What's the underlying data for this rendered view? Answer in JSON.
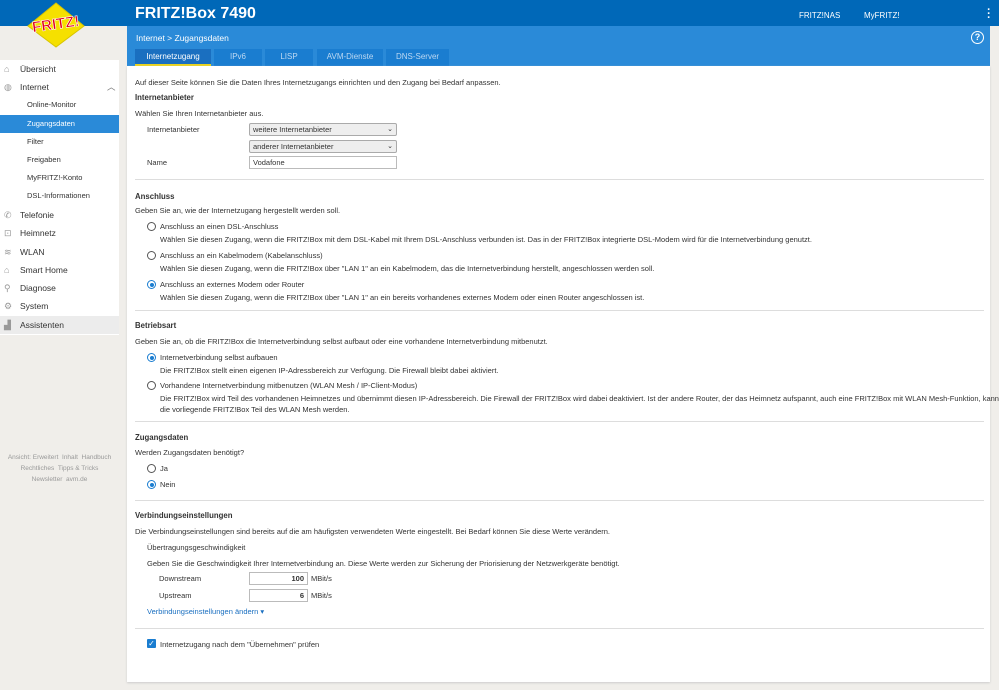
{
  "header": {
    "title": "FRITZ!Box 7490",
    "links": [
      "FRITZ!NAS",
      "MyFRITZ!"
    ],
    "logo_text": "FRITZ!",
    "breadcrumb": "Internet > Zugangsdaten",
    "help": "?"
  },
  "tabs": [
    "Internetzugang",
    "IPv6",
    "LISP",
    "AVM-Dienste",
    "DNS-Server"
  ],
  "sidebar": {
    "items": [
      {
        "label": "Übersicht",
        "icon": "home-icon"
      },
      {
        "label": "Internet",
        "icon": "globe-icon"
      },
      {
        "label": "Online-Monitor"
      },
      {
        "label": "Zugangsdaten",
        "selected": true
      },
      {
        "label": "Filter"
      },
      {
        "label": "Freigaben"
      },
      {
        "label": "MyFRITZ!-Konto"
      },
      {
        "label": "DSL-Informationen"
      },
      {
        "label": "Telefonie",
        "icon": "phone-icon"
      },
      {
        "label": "Heimnetz",
        "icon": "network-icon"
      },
      {
        "label": "WLAN",
        "icon": "wifi-icon"
      },
      {
        "label": "Smart Home",
        "icon": "smarthome-icon"
      },
      {
        "label": "Diagnose",
        "icon": "diagnose-icon"
      },
      {
        "label": "System",
        "icon": "gear-icon"
      },
      {
        "label": "Assistenten",
        "icon": "wizard-icon"
      }
    ],
    "footer": [
      [
        "Ansicht: Erweitert",
        "Inhalt",
        "Handbuch"
      ],
      [
        "Rechtliches",
        "Tipps & Tricks"
      ],
      [
        "Newsletter",
        "avm.de"
      ]
    ]
  },
  "main": {
    "intro": "Auf dieser Seite können Sie die Daten Ihres Internetzugangs einrichten und den Zugang bei Bedarf anpassen.",
    "provider": {
      "heading": "Internetanbieter",
      "text": "Wählen Sie Ihren Internetanbieter aus.",
      "label": "Internetanbieter",
      "select1": "weitere Internetanbieter",
      "select2": "anderer Internetanbieter",
      "name_label": "Name",
      "name_value": "Vodafone"
    },
    "anschluss": {
      "heading": "Anschluss",
      "text": "Geben Sie an, wie der Internetzugang hergestellt werden soll.",
      "options": [
        {
          "label": "Anschluss an einen DSL-Anschluss",
          "desc": "Wählen Sie diesen Zugang, wenn die FRITZ!Box mit dem DSL-Kabel mit Ihrem DSL-Anschluss verbunden ist. Das in der FRITZ!Box integrierte DSL-Modem wird für die Internetverbindung genutzt.",
          "checked": false
        },
        {
          "label": "Anschluss an ein Kabelmodem (Kabelanschluss)",
          "desc": "Wählen Sie diesen Zugang, wenn die FRITZ!Box über \"LAN 1\" an ein Kabelmodem, das die Internetverbindung herstellt, angeschlossen werden soll.",
          "checked": false
        },
        {
          "label": "Anschluss an externes Modem oder Router",
          "desc": "Wählen Sie diesen Zugang, wenn die FRITZ!Box über \"LAN 1\" an ein bereits vorhandenes externes Modem oder einen Router angeschlossen ist.",
          "checked": true
        }
      ]
    },
    "betriebsart": {
      "heading": "Betriebsart",
      "text": "Geben Sie an, ob die FRITZ!Box die Internetverbindung selbst aufbaut oder eine vorhandene Internetverbindung mitbenutzt.",
      "options": [
        {
          "label": "Internetverbindung selbst aufbauen",
          "desc": "Die FRITZ!Box stellt einen eigenen IP-Adressbereich zur Verfügung. Die Firewall bleibt dabei aktiviert.",
          "checked": true
        },
        {
          "label": "Vorhandene Internetverbindung mitbenutzen (WLAN Mesh / IP-Client-Modus)",
          "desc": "Die FRITZ!Box wird Teil des vorhandenen Heimnetzes und übernimmt diesen IP-Adressbereich. Die Firewall der FRITZ!Box wird dabei deaktiviert. Ist der andere Router, der das Heimnetz aufspannt, auch eine FRITZ!Box mit WLAN Mesh-Funktion, kann",
          "desc2": "die vorliegende FRITZ!Box Teil des WLAN Mesh werden.",
          "checked": false
        }
      ]
    },
    "zugang": {
      "heading": "Zugangsdaten",
      "text": "Werden Zugangsdaten benötigt?",
      "options": [
        {
          "label": "Ja",
          "checked": false
        },
        {
          "label": "Nein",
          "checked": true
        }
      ]
    },
    "verbindung": {
      "heading": "Verbindungseinstellungen",
      "text": "Die Verbindungseinstellungen sind bereits auf die am häufigsten verwendeten Werte eingestellt. Bei Bedarf können Sie diese Werte verändern.",
      "sub": "Übertragungsgeschwindigkeit",
      "subtext": "Geben Sie die Geschwindigkeit Ihrer Internetverbindung an. Diese Werte werden zur Sicherung der Priorisierung der Netzwerkgeräte benötigt.",
      "down_label": "Downstream",
      "down_value": "100",
      "up_label": "Upstream",
      "up_value": "6",
      "unit": "MBit/s",
      "link": "Verbindungseinstellungen ändern ▾"
    },
    "check": {
      "label": "Internetzugang nach dem \"Übernehmen\" prüfen",
      "checked": true
    }
  }
}
